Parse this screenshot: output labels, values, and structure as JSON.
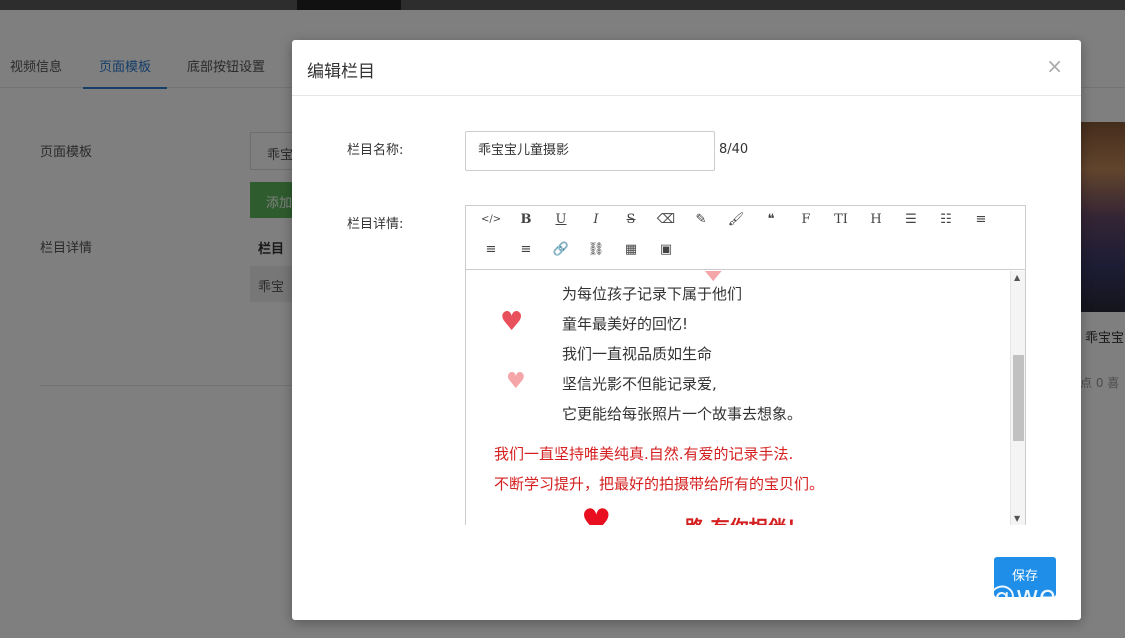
{
  "tabs": [
    "视频信息",
    "页面模板",
    "底部按钮设置"
  ],
  "background": {
    "template_label": "页面模板",
    "input_value": "乖宝",
    "add_button": "添加",
    "detail_label": "栏目详情",
    "table_header": "栏目",
    "table_cell": "乖宝",
    "right_title": "乖宝宝",
    "right_stats": "点   0 喜"
  },
  "modal": {
    "title": "编辑栏目",
    "close": "×",
    "name_label": "栏目名称:",
    "name_value": "乖宝宝儿童摄影",
    "name_counter": "8/40",
    "detail_label": "栏目详情:",
    "toolbar_icons": [
      "code-icon",
      "bold-icon",
      "underline-icon",
      "italic-icon",
      "strikethrough-icon",
      "eraser-icon",
      "pen-icon",
      "brush-icon",
      "quote-icon",
      "font-icon",
      "text-size-icon",
      "heading-icon",
      "unordered-list-icon",
      "ordered-list-icon",
      "align-left-icon",
      "align-center-icon",
      "align-right-icon",
      "link-icon",
      "unlink-icon",
      "table-icon",
      "image-icon"
    ],
    "toolbar_glyphs": [
      "</>",
      "B",
      "U",
      "I",
      "S",
      "⌫",
      "✎",
      "🖌",
      "❝",
      "F",
      "TI",
      "H",
      "☰",
      "☷",
      "≡",
      "≡",
      "≡",
      "🔗",
      "⛓",
      "▦",
      "▣"
    ],
    "content_lines": [
      "为每位孩子记录下属于他们",
      "童年最美好的回忆!",
      "我们一直视品质如生命",
      "坚信光影不但能记录爱,",
      "它更能给每张照片一个故事去想象。"
    ],
    "red_lines": [
      "我们一直坚持唯美纯真.自然.有爱的记录手法.",
      "不断学习提升，把最好的拍摄带给所有的宝贝们。"
    ],
    "partial_line": "一路  有你相伴！",
    "save_button": "保存"
  },
  "watermark": "知乎 @weii",
  "colors": {
    "accent": "#2b7cd3",
    "save": "#1e8ee8",
    "red_text": "#d42020",
    "heart": "#e8505b",
    "heart_light": "#f4a6a8"
  }
}
